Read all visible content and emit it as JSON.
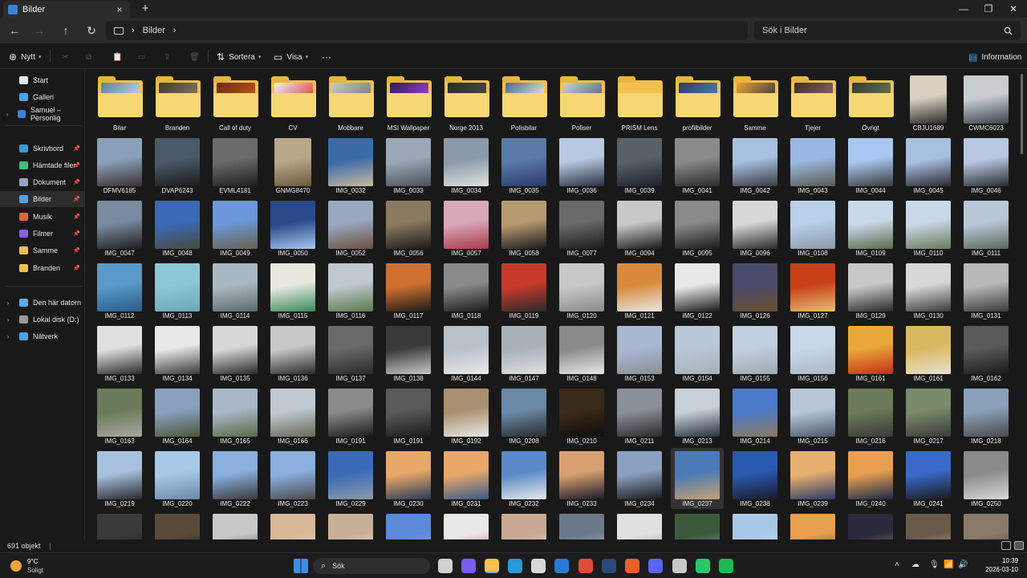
{
  "window": {
    "tab_title": "Bilder",
    "close_tab": "×",
    "new_tab": "+",
    "minimize": "—",
    "maximize": "❐",
    "close": "✕"
  },
  "address": {
    "back": "←",
    "forward": "→",
    "up": "↑",
    "refresh": "↻",
    "crumbs": [
      "Bilder"
    ],
    "chevron": "›",
    "search_placeholder": "Sök i Bilder"
  },
  "toolbar": {
    "new_label": "Nytt",
    "sort_label": "Sortera",
    "view_label": "Visa",
    "more": "···",
    "info_label": "Information"
  },
  "sidebar": {
    "items": [
      {
        "label": "Start",
        "icon": "home-icon",
        "color": "#e8e8e8",
        "chev": ""
      },
      {
        "label": "Galleri",
        "icon": "gallery-icon",
        "color": "#4aa3e8",
        "chev": ""
      },
      {
        "label": "Samuel – Personlig",
        "icon": "cloud-icon",
        "color": "#3b82d6",
        "chev": "›"
      },
      {
        "label": "Skrivbord",
        "icon": "desktop-icon",
        "color": "#3b9bd6",
        "chev": "",
        "pin": true
      },
      {
        "label": "Hämtade filer",
        "icon": "download-icon",
        "color": "#3fbf7f",
        "chev": "",
        "pin": true
      },
      {
        "label": "Dokument",
        "icon": "document-icon",
        "color": "#8fa8c8",
        "chev": "",
        "pin": true
      },
      {
        "label": "Bilder",
        "icon": "pictures-icon",
        "color": "#4aa3e8",
        "chev": "",
        "pin": true,
        "selected": true
      },
      {
        "label": "Musik",
        "icon": "music-icon",
        "color": "#e8603c",
        "chev": "",
        "pin": true
      },
      {
        "label": "Filmer",
        "icon": "video-icon",
        "color": "#8a5cf0",
        "chev": "",
        "pin": true
      },
      {
        "label": "Samme",
        "icon": "folder-icon",
        "color": "#f2c14e",
        "chev": "",
        "pin": true
      },
      {
        "label": "Branden",
        "icon": "folder-icon",
        "color": "#f2c14e",
        "chev": "",
        "pin": true
      },
      {
        "label": "Den här datorn",
        "icon": "pc-icon",
        "color": "#5aaee8",
        "chev": "›"
      },
      {
        "label": "Lokal disk (D:)",
        "icon": "drive-icon",
        "color": "#9a9a9a",
        "chev": "›"
      },
      {
        "label": "Nätverk",
        "icon": "network-icon",
        "color": "#4aa3e8",
        "chev": "›"
      }
    ]
  },
  "items": [
    {
      "name": "Bilar",
      "type": "folder",
      "c1": "#5b7fa3",
      "c2": "#c9d4df"
    },
    {
      "name": "Branden",
      "type": "folder",
      "c1": "#3d3a30",
      "c2": "#8a7a55"
    },
    {
      "name": "Call of duty",
      "type": "folder",
      "c1": "#6b2a10",
      "c2": "#c2551b"
    },
    {
      "name": "CV",
      "type": "folder",
      "c1": "#f0f0f0",
      "c2": "#d94a3a"
    },
    {
      "name": "Mobbare",
      "type": "folder",
      "c1": "#c8c8c8",
      "c2": "#7a7a7a"
    },
    {
      "name": "MSI Wallpaper",
      "type": "folder",
      "c1": "#2a1a5e",
      "c2": "#a23fd6"
    },
    {
      "name": "Norge 2013",
      "type": "folder",
      "c1": "#2a2a2a",
      "c2": "#4a4a4a"
    },
    {
      "name": "Polisbilar",
      "type": "folder",
      "c1": "#4a6a8a",
      "c2": "#e8e8e8"
    },
    {
      "name": "Poliser",
      "type": "folder",
      "c1": "#c8d0d8",
      "c2": "#5a6a7a"
    },
    {
      "name": "PRISM Lens",
      "type": "folder",
      "c1": "#f2c14e",
      "c2": "#f2c14e"
    },
    {
      "name": "profilbilder",
      "type": "folder",
      "c1": "#2a3a6a",
      "c2": "#5a7ab0"
    },
    {
      "name": "Samme",
      "type": "folder",
      "c1": "#e8a33a",
      "c2": "#3a3a3a"
    },
    {
      "name": "Tjejer",
      "type": "folder",
      "c1": "#3a2a2a",
      "c2": "#8a6a5a"
    },
    {
      "name": "Övrigt",
      "type": "folder",
      "c1": "#2e3a2a",
      "c2": "#6a7a4a"
    },
    {
      "name": "CBJU1689",
      "type": "img",
      "portrait": true,
      "c1": "#d8cfc0",
      "c2": "#2a2a2a"
    },
    {
      "name": "CWMC6023",
      "type": "img",
      "c1": "#c8ccd0",
      "c2": "#3a4250"
    },
    {
      "name": "DFMV6185",
      "type": "img",
      "c1": "#8aa0b8",
      "c2": "#3a3030"
    },
    {
      "name": "DVAP6243",
      "type": "img",
      "c1": "#4a5a6a",
      "c2": "#1a1a1a"
    },
    {
      "name": "EVML4181",
      "type": "img",
      "c1": "#6a6a6a",
      "c2": "#1e1e1e"
    },
    {
      "name": "GNMG8470",
      "type": "img",
      "portrait": true,
      "c1": "#b8a888",
      "c2": "#6a5a40"
    },
    {
      "name": "IMG_0032",
      "type": "img",
      "c1": "#3a6aa8",
      "c2": "#c8b8a0"
    },
    {
      "name": "IMG_0033",
      "type": "img",
      "c1": "#9aa8b8",
      "c2": "#4a5058"
    },
    {
      "name": "IMG_0034",
      "type": "img",
      "c1": "#8a9aa8",
      "c2": "#e0e0e0"
    },
    {
      "name": "IMG_0035",
      "type": "img",
      "c1": "#5a7aa8",
      "c2": "#2a3a6a"
    },
    {
      "name": "IMG_0036",
      "type": "img",
      "c1": "#b8c8e0",
      "c2": "#2a3040"
    },
    {
      "name": "IMG_0039",
      "type": "img",
      "c1": "#5a6068",
      "c2": "#1e2228"
    },
    {
      "name": "IMG_0041",
      "type": "img",
      "c1": "#8a8a8a",
      "c2": "#2a2a2a"
    },
    {
      "name": "IMG_0042",
      "type": "img",
      "c1": "#a8c0e0",
      "c2": "#3a3a40"
    },
    {
      "name": "IMG_0043",
      "type": "img",
      "c1": "#9ab8e0",
      "c2": "#5a5a50"
    },
    {
      "name": "IMG_0044",
      "type": "img",
      "c1": "#a8c8f0",
      "c2": "#3a3a3a"
    },
    {
      "name": "IMG_0045",
      "type": "img",
      "c1": "#a8c0e0",
      "c2": "#2a2a30"
    },
    {
      "name": "IMG_0046",
      "type": "img",
      "c1": "#b8c8e0",
      "c2": "#2a2a30"
    },
    {
      "name": "IMG_0047",
      "type": "img",
      "c1": "#7a8aa0",
      "c2": "#1e1e1e"
    },
    {
      "name": "IMG_0048",
      "type": "img",
      "c1": "#3a6ab8",
      "c2": "#4a4a3a"
    },
    {
      "name": "IMG_0049",
      "type": "img",
      "c1": "#6a98d8",
      "c2": "#6a6050"
    },
    {
      "name": "IMG_0050",
      "type": "img",
      "c1": "#2a4a8a",
      "c2": "#a8c8f0"
    },
    {
      "name": "IMG_0052",
      "type": "img",
      "c1": "#9aa8c0",
      "c2": "#6a5040"
    },
    {
      "name": "IMG_0056",
      "type": "img",
      "c1": "#8a7a60",
      "c2": "#1a1a1a"
    },
    {
      "name": "IMG_0057",
      "type": "img",
      "c1": "#d8a8b8",
      "c2": "#a83a4a"
    },
    {
      "name": "IMG_0058",
      "type": "img",
      "c1": "#b89a70",
      "c2": "#1a1a1a"
    },
    {
      "name": "IMG_0077",
      "type": "img",
      "c1": "#6a6a6a",
      "c2": "#1a1a1a"
    },
    {
      "name": "IMG_0094",
      "type": "img",
      "c1": "#c8c8c8",
      "c2": "#1a1a1a"
    },
    {
      "name": "IMG_0095",
      "type": "img",
      "c1": "#8a8a8a",
      "c2": "#1a1a1a"
    },
    {
      "name": "IMG_0096",
      "type": "img",
      "c1": "#d8d8d8",
      "c2": "#2a2a2a"
    },
    {
      "name": "IMG_0108",
      "type": "img",
      "c1": "#b8d0e8",
      "c2": "#8a9aa8"
    },
    {
      "name": "IMG_0109",
      "type": "img",
      "c1": "#c8d8e8",
      "c2": "#5a6a4a"
    },
    {
      "name": "IMG_0110",
      "type": "img",
      "c1": "#c8d8e8",
      "c2": "#6a7a5a"
    },
    {
      "name": "IMG_0111",
      "type": "img",
      "c1": "#b8c8d8",
      "c2": "#5a6a5a"
    },
    {
      "name": "IMG_0112",
      "type": "img",
      "c1": "#5a9ac8",
      "c2": "#2a5a8a"
    },
    {
      "name": "IMG_0113",
      "type": "img",
      "c1": "#8ac8d8",
      "c2": "#6aa8b8"
    },
    {
      "name": "IMG_0114",
      "type": "img",
      "c1": "#a8b8c0",
      "c2": "#5a6a6a"
    },
    {
      "name": "IMG_0115",
      "type": "img",
      "c1": "#e8e8e0",
      "c2": "#3a8a5a"
    },
    {
      "name": "IMG_0116",
      "type": "img",
      "c1": "#c0c8d0",
      "c2": "#5a7a4a"
    },
    {
      "name": "IMG_0117",
      "type": "img",
      "c1": "#d07030",
      "c2": "#1a1a1a"
    },
    {
      "name": "IMG_0118",
      "type": "img",
      "c1": "#8a8a8a",
      "c2": "#1a1a1a"
    },
    {
      "name": "IMG_0119",
      "type": "img",
      "c1": "#c83a2a",
      "c2": "#2a2a2a"
    },
    {
      "name": "IMG_0120",
      "type": "img",
      "c1": "#c8c8c8",
      "c2": "#8a8a8a"
    },
    {
      "name": "IMG_0121",
      "type": "img",
      "c1": "#d88a3a",
      "c2": "#e8e8e8"
    },
    {
      "name": "IMG_0122",
      "type": "img",
      "c1": "#e8e8e8",
      "c2": "#1a1a1a"
    },
    {
      "name": "IMG_0126",
      "type": "img",
      "c1": "#4a4a6a",
      "c2": "#6a5030"
    },
    {
      "name": "IMG_0127",
      "type": "img",
      "c1": "#c8401a",
      "c2": "#e8c070"
    },
    {
      "name": "IMG_0129",
      "type": "img",
      "c1": "#c8c8c8",
      "c2": "#2a2a2a"
    },
    {
      "name": "IMG_0130",
      "type": "img",
      "c1": "#d8d8d8",
      "c2": "#3a3a3a"
    },
    {
      "name": "IMG_0131",
      "type": "img",
      "c1": "#b8b8b8",
      "c2": "#3a3a3a"
    },
    {
      "name": "IMG_0133",
      "type": "img",
      "c1": "#e0e0e0",
      "c2": "#2a2a2a"
    },
    {
      "name": "IMG_0134",
      "type": "img",
      "c1": "#e8e8e8",
      "c2": "#3a3a3a"
    },
    {
      "name": "IMG_0135",
      "type": "img",
      "c1": "#d8d8d8",
      "c2": "#2a2a2a"
    },
    {
      "name": "IMG_0136",
      "type": "img",
      "c1": "#c8c8c8",
      "c2": "#2a2a2a"
    },
    {
      "name": "IMG_0137",
      "type": "img",
      "c1": "#6a6a6a",
      "c2": "#2a2a2a"
    },
    {
      "name": "IMG_0138",
      "type": "img",
      "c1": "#3a3a3a",
      "c2": "#c8c8c8"
    },
    {
      "name": "IMG_0144",
      "type": "img",
      "c1": "#b8c0c8",
      "c2": "#e8e8e8"
    },
    {
      "name": "IMG_0147",
      "type": "img",
      "c1": "#a8b0b8",
      "c2": "#e0e0e0"
    },
    {
      "name": "IMG_0148",
      "type": "img",
      "c1": "#8a8a8a",
      "c2": "#e8e8e8"
    },
    {
      "name": "IMG_0153",
      "type": "img",
      "c1": "#a8b8d0",
      "c2": "#8a9098"
    },
    {
      "name": "IMG_0154",
      "type": "img",
      "c1": "#b8c8d8",
      "c2": "#a8b0b8"
    },
    {
      "name": "IMG_0155",
      "type": "img",
      "c1": "#c0d0e0",
      "c2": "#a0a8b0"
    },
    {
      "name": "IMG_0156",
      "type": "img",
      "c1": "#c8d8e8",
      "c2": "#a8b8c8"
    },
    {
      "name": "IMG_0161",
      "type": "img",
      "c1": "#e8a83a",
      "c2": "#c82a1a"
    },
    {
      "name": "IMG_0161",
      "type": "img",
      "c1": "#d8b860",
      "c2": "#e8e0d0"
    },
    {
      "name": "IMG_0162",
      "type": "img",
      "c1": "#5a5a5a",
      "c2": "#1a1a1a"
    },
    {
      "name": "IMG_0163",
      "type": "img",
      "c1": "#6a7a5a",
      "c2": "#a8a8a0"
    },
    {
      "name": "IMG_0164",
      "type": "img",
      "c1": "#8aa0c0",
      "c2": "#4a5a3a"
    },
    {
      "name": "IMG_0165",
      "type": "img",
      "c1": "#a8b8c8",
      "c2": "#5a6a4a"
    },
    {
      "name": "IMG_0166",
      "type": "img",
      "c1": "#c0c8d0",
      "c2": "#6a6a5a"
    },
    {
      "name": "IMG_0191",
      "type": "img",
      "c1": "#8a8a8a",
      "c2": "#1a1a1a"
    },
    {
      "name": "IMG_0191",
      "type": "img",
      "c1": "#5a5a5a",
      "c2": "#1a1a1a"
    },
    {
      "name": "IMG_0192",
      "type": "img",
      "c1": "#a89070",
      "c2": "#e8e8e8"
    },
    {
      "name": "IMG_0208",
      "type": "img",
      "c1": "#6a8aa8",
      "c2": "#2a2a2a"
    },
    {
      "name": "IMG_0210",
      "type": "img",
      "c1": "#3a2a1a",
      "c2": "#0e0e0e"
    },
    {
      "name": "IMG_0211",
      "type": "img",
      "c1": "#8a9098",
      "c2": "#2a2a2a"
    },
    {
      "name": "IMG_0213",
      "type": "img",
      "c1": "#c8d0d8",
      "c2": "#2a3040"
    },
    {
      "name": "IMG_0214",
      "type": "img",
      "c1": "#4a7ac8",
      "c2": "#8a7a60"
    },
    {
      "name": "IMG_0215",
      "type": "img",
      "c1": "#b8c8d8",
      "c2": "#4a5a6a"
    },
    {
      "name": "IMG_0216",
      "type": "img",
      "c1": "#6a7a5a",
      "c2": "#3a3a3a"
    },
    {
      "name": "IMG_0217",
      "type": "img",
      "c1": "#7a8a6a",
      "c2": "#3a3a3a"
    },
    {
      "name": "IMG_0218",
      "type": "img",
      "c1": "#8aa0b8",
      "c2": "#4a4a4a"
    },
    {
      "name": "IMG_0219",
      "type": "img",
      "c1": "#a8c0e0",
      "c2": "#2a2a2a"
    },
    {
      "name": "IMG_0220",
      "type": "img",
      "c1": "#a8c8e8",
      "c2": "#6a8aa8"
    },
    {
      "name": "IMG_0222",
      "type": "img",
      "c1": "#8ab0e0",
      "c2": "#3a3a3a"
    },
    {
      "name": "IMG_0223",
      "type": "img",
      "c1": "#8ab0e0",
      "c2": "#4a4a4a"
    },
    {
      "name": "IMG_0229",
      "type": "img",
      "c1": "#3a6ab8",
      "c2": "#8a9aa8"
    },
    {
      "name": "IMG_0230",
      "type": "img",
      "c1": "#e8a86a",
      "c2": "#2a3a5a"
    },
    {
      "name": "IMG_0231",
      "type": "img",
      "c1": "#e8a86a",
      "c2": "#3a5a8a"
    },
    {
      "name": "IMG_0232",
      "type": "img",
      "c1": "#5a8ac8",
      "c2": "#e8e8e8"
    },
    {
      "name": "IMG_0233",
      "type": "img",
      "c1": "#d8a070",
      "c2": "#1a1a2a"
    },
    {
      "name": "IMG_0234",
      "type": "img",
      "c1": "#8aa0c0",
      "c2": "#1a1a1a"
    },
    {
      "name": "IMG_0237",
      "type": "img",
      "c1": "#4a7ab8",
      "c2": "#c8a070",
      "highlight": true
    },
    {
      "name": "IMG_0238",
      "type": "img",
      "c1": "#2a5ab0",
      "c2": "#1a1a2a"
    },
    {
      "name": "IMG_0239",
      "type": "img",
      "c1": "#e8b070",
      "c2": "#2a3a6a"
    },
    {
      "name": "IMG_0240",
      "type": "img",
      "c1": "#e8a050",
      "c2": "#1a2a4a"
    },
    {
      "name": "IMG_0241",
      "type": "img",
      "c1": "#3a6ac8",
      "c2": "#1a1a1a"
    },
    {
      "name": "IMG_0250",
      "type": "img",
      "c1": "#8a8a8a",
      "c2": "#d8d8d8"
    },
    {
      "name": "",
      "type": "img",
      "c1": "#3a3a3a",
      "c2": "#1a1a1a"
    },
    {
      "name": "",
      "type": "img",
      "c1": "#5a4a3a",
      "c2": "#1a1a1a"
    },
    {
      "name": "",
      "type": "img",
      "c1": "#c8c8c8",
      "c2": "#3a3a3a"
    },
    {
      "name": "",
      "type": "img",
      "c1": "#d8b898",
      "c2": "#e8e8e8"
    },
    {
      "name": "",
      "type": "img",
      "c1": "#c8b098",
      "c2": "#f0f0f0"
    },
    {
      "name": "",
      "type": "img",
      "c1": "#5a8ad8",
      "c2": "#8ab0e8"
    },
    {
      "name": "",
      "type": "img",
      "c1": "#e8e8e8",
      "c2": "#c84a3a"
    },
    {
      "name": "",
      "type": "img",
      "c1": "#c8a890",
      "c2": "#e8e8e8"
    },
    {
      "name": "",
      "type": "img",
      "c1": "#6a7a8a",
      "c2": "#c8c8c8"
    },
    {
      "name": "",
      "type": "img",
      "c1": "#e0e0e0",
      "c2": "#8a8a8a"
    },
    {
      "name": "",
      "type": "img",
      "c1": "#3a5a3a",
      "c2": "#8ab0e0"
    },
    {
      "name": "",
      "type": "img",
      "c1": "#a8c8e8",
      "c2": "#e8e8e8"
    },
    {
      "name": "",
      "type": "img",
      "c1": "#e8a050",
      "c2": "#2a3a6a"
    },
    {
      "name": "",
      "type": "img",
      "c1": "#2a2a3a",
      "c2": "#c8a070"
    },
    {
      "name": "",
      "type": "img",
      "c1": "#6a5a4a",
      "c2": "#c8b8a0"
    },
    {
      "name": "",
      "type": "img",
      "c1": "#8a7a6a",
      "c2": "#3a3a3a"
    }
  ],
  "status": {
    "count": "691 objekt",
    "cursor": "|"
  },
  "taskbar": {
    "temp": "9°C",
    "condition": "Soligt",
    "search_label": "Sök",
    "time": "10:39",
    "date": "2026-03-10",
    "apps": [
      {
        "icon": "start-icon",
        "color": "#3b8ee8"
      },
      {
        "icon": "task-view-icon",
        "color": "#d0d0d0"
      },
      {
        "icon": "copilot-icon",
        "color": "#7a5cf0"
      },
      {
        "icon": "file-explorer-icon",
        "color": "#f2c14e"
      },
      {
        "icon": "edge-icon",
        "color": "#2a9ad8"
      },
      {
        "icon": "store-icon",
        "color": "#d8d8d8"
      },
      {
        "icon": "outlook-icon",
        "color": "#2a7ad8"
      },
      {
        "icon": "chrome-icon",
        "color": "#e04a3a"
      },
      {
        "icon": "steam-icon",
        "color": "#2a4a7a"
      },
      {
        "icon": "firefox-icon",
        "color": "#e8602a"
      },
      {
        "icon": "discord-icon",
        "color": "#5865f2"
      },
      {
        "icon": "app-icon",
        "color": "#c8c8c8"
      },
      {
        "icon": "app-green-icon",
        "color": "#2ac86a"
      },
      {
        "icon": "spotify-icon",
        "color": "#1db954"
      }
    ],
    "tray": [
      "˄",
      "☁",
      "🎙",
      "📶",
      "🔊"
    ]
  }
}
